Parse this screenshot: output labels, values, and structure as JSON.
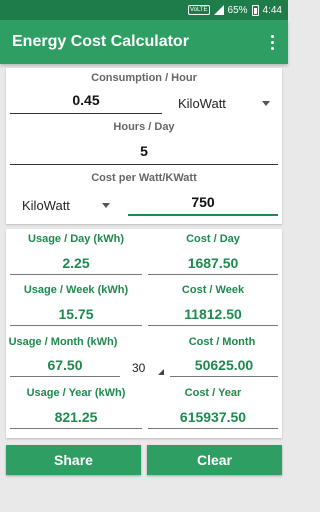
{
  "status": {
    "network": "VoLTE",
    "battery": "65%",
    "time": "4:44"
  },
  "appbar": {
    "title": "Energy Cost Calculator"
  },
  "input": {
    "consumption_label": "Consumption / Hour",
    "consumption_value": "0.45",
    "consumption_unit": "KiloWatt",
    "hours_label": "Hours / Day",
    "hours_value": "5",
    "cost_label": "Cost per Watt/KWatt",
    "cost_unit": "KiloWatt",
    "cost_value": "750"
  },
  "results": {
    "usage_day_label": "Usage / Day (kWh)",
    "usage_day_value": "2.25",
    "cost_day_label": "Cost / Day",
    "cost_day_value": "1687.50",
    "usage_week_label": "Usage / Week (kWh)",
    "usage_week_value": "15.75",
    "cost_week_label": "Cost / Week",
    "cost_week_value": "11812.50",
    "usage_month_label": "Usage / Month (kWh)",
    "usage_month_value": "67.50",
    "days_in_month": "30",
    "cost_month_label": "Cost / Month",
    "cost_month_value": "50625.00",
    "usage_year_label": "Usage / Year (kWh)",
    "usage_year_value": "821.25",
    "cost_year_label": "Cost / Year",
    "cost_year_value": "615937.50"
  },
  "buttons": {
    "share": "Share",
    "clear": "Clear"
  }
}
